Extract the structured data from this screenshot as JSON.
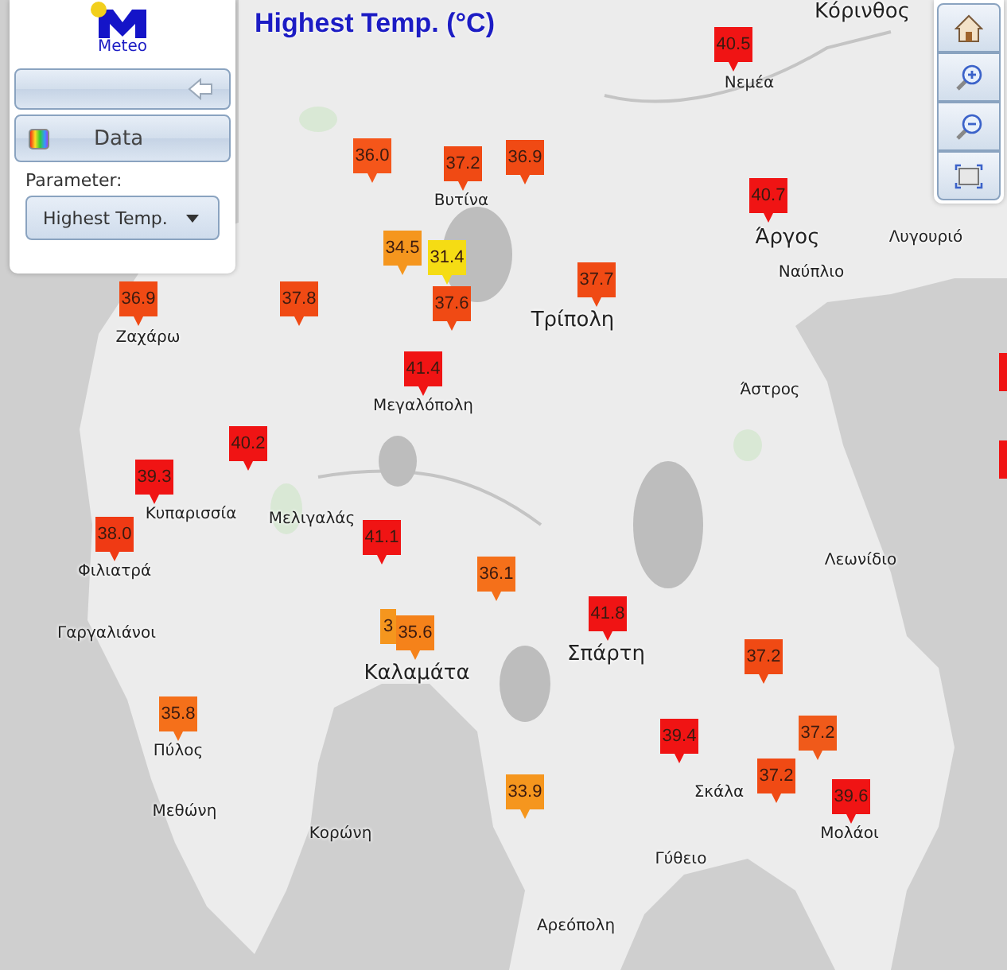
{
  "panel": {
    "logo_text": "Meteo",
    "data_button": "Data",
    "parameter_label": "Parameter:",
    "parameter_value": "Highest Temp."
  },
  "map_title": "Highest Temp. (°C)",
  "toolbar": [
    {
      "kind": "home"
    },
    {
      "kind": "zoom-in"
    },
    {
      "kind": "zoom-out"
    },
    {
      "kind": "extent"
    }
  ],
  "towns": [
    "Κόρινθος",
    "Νεμέα",
    "Βυτίνα",
    "Άργος",
    "Λυγουριό",
    "Ναύπλιο",
    "Τρίπολη",
    "Ζαχάρω",
    "Μεγαλόπολη",
    "Άστρος",
    "Κυπαρισσία",
    "Μελιγαλάς",
    "Φιλιατρά",
    "Λεωνίδιο",
    "Γαργαλιάνοι",
    "Σπάρτη",
    "Καλαμάτα",
    "Πύλος",
    "Μεθώνη",
    "Κορώνη",
    "Σκάλα",
    "Μολάοι",
    "Γύθειο",
    "Αρεόπολη"
  ],
  "markers": [
    {
      "value": "40.5",
      "color": "#f01414"
    },
    {
      "value": "36.0",
      "color": "#f5561a"
    },
    {
      "value": "37.2",
      "color": "#f04a14"
    },
    {
      "value": "36.9",
      "color": "#f04a14"
    },
    {
      "value": "40.7",
      "color": "#f01414"
    },
    {
      "value": "34.5",
      "color": "#f5961e"
    },
    {
      "value": "31.4",
      "color": "#f5dc14"
    },
    {
      "value": "37.6",
      "color": "#f04a14"
    },
    {
      "value": "37.7",
      "color": "#f04a14"
    },
    {
      "value": "36.9",
      "color": "#f04a14"
    },
    {
      "value": "37.8",
      "color": "#f04a14"
    },
    {
      "value": "41.4",
      "color": "#f01414"
    },
    {
      "value": "40.2",
      "color": "#f01414"
    },
    {
      "value": "39.3",
      "color": "#f01414"
    },
    {
      "value": "38.0",
      "color": "#f03a14"
    },
    {
      "value": "41.1",
      "color": "#f01414"
    },
    {
      "value": "36.1",
      "color": "#f5701a"
    },
    {
      "value": "41.8",
      "color": "#f01414"
    },
    {
      "value": "3",
      "color": "#f5961e"
    },
    {
      "value": "35.6",
      "color": "#f5821a"
    },
    {
      "value": "37.2",
      "color": "#f04a14"
    },
    {
      "value": "35.8",
      "color": "#f5701a"
    },
    {
      "value": "39.4",
      "color": "#f01414"
    },
    {
      "value": "37.2",
      "color": "#f05a1a"
    },
    {
      "value": "37.2",
      "color": "#f04a14"
    },
    {
      "value": "39.6",
      "color": "#f01414"
    },
    {
      "value": "33.9",
      "color": "#f5961e"
    }
  ],
  "edge_markers": [
    {
      "color": "#f01414"
    },
    {
      "color": "#f01414"
    }
  ]
}
